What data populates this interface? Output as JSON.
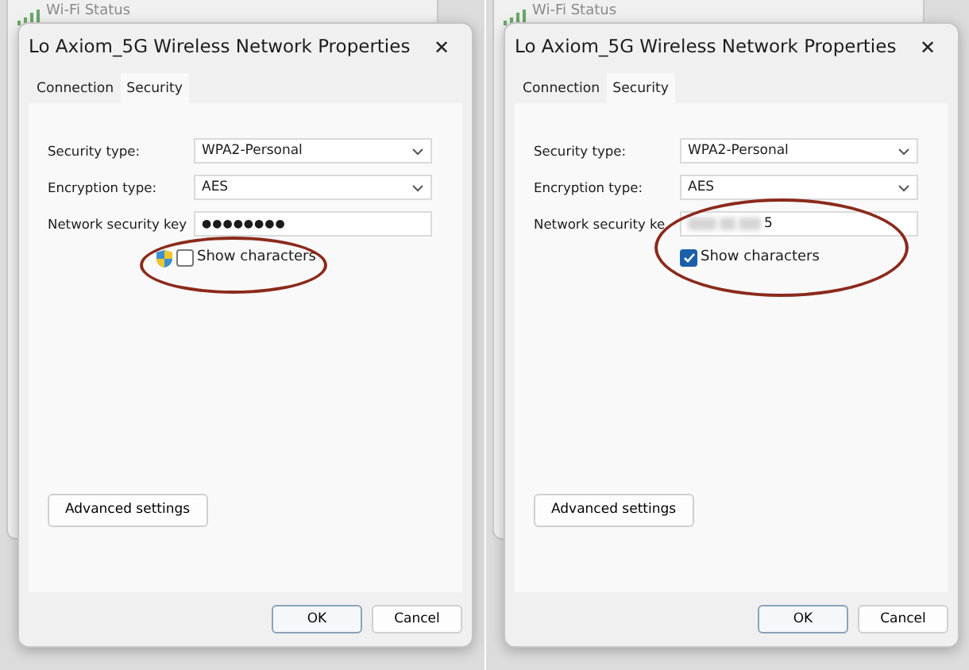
{
  "panels": [
    {
      "background_window": {
        "title": "Wi-Fi Status"
      },
      "dialog": {
        "title": "Lo Axiom_5G Wireless Network Properties",
        "close": "✕",
        "tabs": [
          {
            "label": "Connection",
            "selected": false
          },
          {
            "label": "Security",
            "selected": true
          }
        ],
        "fields": [
          {
            "kind": "select",
            "label": "Security type:",
            "value": "WPA2-Personal"
          },
          {
            "kind": "select",
            "label": "Encryption type:",
            "value": "AES"
          },
          {
            "kind": "masked",
            "label": "Network security key",
            "value": "●●●●●●●●"
          }
        ],
        "show_characters": {
          "label": "Show characters",
          "checked": false,
          "shield": true
        },
        "advanced_button": "Advanced settings",
        "buttons": [
          "OK",
          "Cancel"
        ],
        "highlight": {
          "kind": "checkbox"
        }
      }
    },
    {
      "background_window": {
        "title": "Wi-Fi Status"
      },
      "dialog": {
        "title": "Lo Axiom_5G Wireless Network Properties",
        "close": "✕",
        "tabs": [
          {
            "label": "Connection",
            "selected": false
          },
          {
            "label": "Security",
            "selected": true
          }
        ],
        "fields": [
          {
            "kind": "select",
            "label": "Security type:",
            "value": "WPA2-Personal"
          },
          {
            "kind": "select",
            "label": "Encryption type:",
            "value": "AES"
          },
          {
            "kind": "blurred",
            "label": "Network security ke",
            "value": "5"
          }
        ],
        "show_characters": {
          "label": "Show characters",
          "checked": true,
          "shield": false
        },
        "advanced_button": "Advanced settings",
        "buttons": [
          "OK",
          "Cancel"
        ],
        "highlight": {
          "kind": "key_and_checkbox"
        }
      }
    }
  ]
}
